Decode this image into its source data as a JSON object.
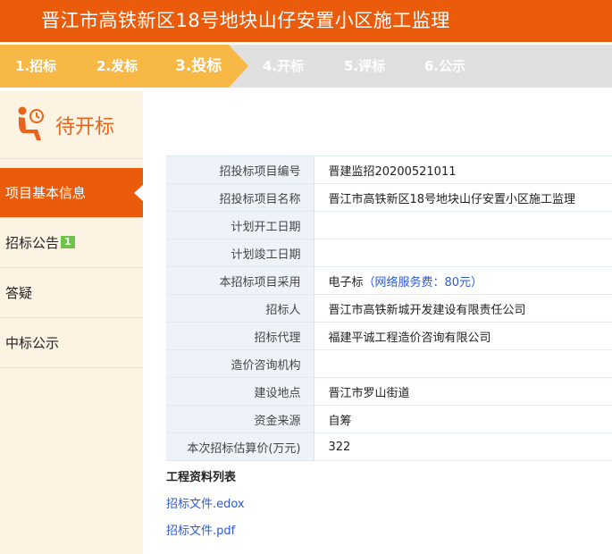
{
  "header": {
    "title": "晋江市高铁新区18号地块山仔安置小区施工监理"
  },
  "steps": [
    {
      "label": "1.招标",
      "state": "done"
    },
    {
      "label": "2.发标",
      "state": "done"
    },
    {
      "label": "3.投标",
      "state": "current"
    },
    {
      "label": "4.开标",
      "state": "pending"
    },
    {
      "label": "5.评标",
      "state": "pending"
    },
    {
      "label": "6.公示",
      "state": "pending"
    }
  ],
  "sidebar": {
    "status": "待开标",
    "items": [
      {
        "label": "项目基本信息",
        "active": true
      },
      {
        "label": "招标公告",
        "badge": "1"
      },
      {
        "label": "答疑"
      },
      {
        "label": "中标公示"
      }
    ]
  },
  "info_rows": [
    {
      "label": "招投标项目编号",
      "value": "晋建监招20200521011"
    },
    {
      "label": "招投标项目名称",
      "value": "晋江市高铁新区18号地块山仔安置小区施工监理"
    },
    {
      "label": "计划开工日期",
      "value": ""
    },
    {
      "label": "计划竣工日期",
      "value": ""
    },
    {
      "label": "本招标项目采用",
      "value": "电子标",
      "fee": "（网络服务费：80元）"
    },
    {
      "label": "招标人",
      "value": "晋江市高铁新城开发建设有限责任公司"
    },
    {
      "label": "招标代理",
      "value": "福建平诚工程造价咨询有限公司"
    },
    {
      "label": "造价咨询机构",
      "value": ""
    },
    {
      "label": "建设地点",
      "value": "晋江市罗山街道"
    },
    {
      "label": "资金来源",
      "value": "自筹"
    },
    {
      "label": "本次招标估算价(万元)",
      "value": "322"
    }
  ],
  "files": {
    "title": "工程资料列表",
    "items": [
      "招标文件.edox",
      "招标文件.pdf"
    ]
  },
  "colors": {
    "brand_orange": "#ea5c0c",
    "step_done": "#f7b846",
    "step_pending": "#e0e0e0",
    "link_blue": "#2c5ad6"
  }
}
